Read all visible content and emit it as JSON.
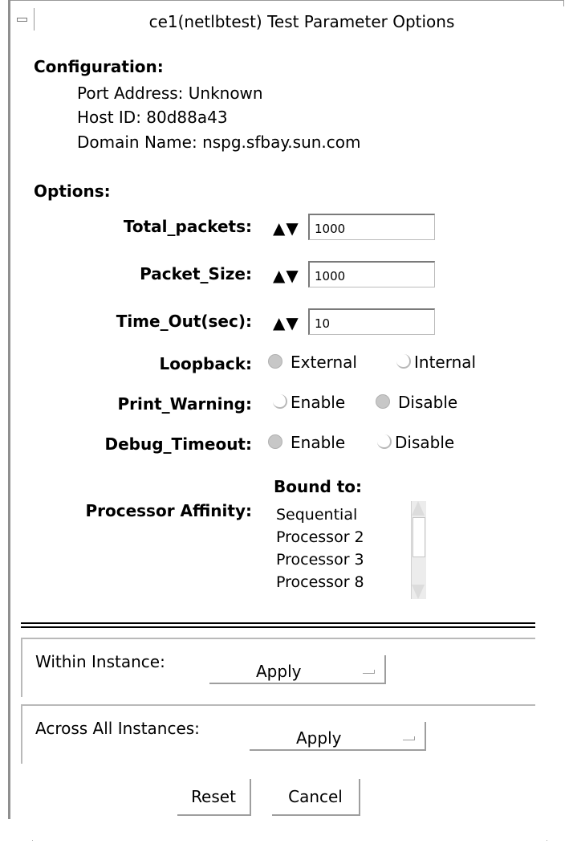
{
  "window": {
    "title": "ce1(netlbtest) Test Parameter Options"
  },
  "configuration": {
    "heading": "Configuration:",
    "port_address": "Port Address: Unknown",
    "host_id": "Host ID: 80d88a43",
    "domain_name": "Domain Name: nspg.sfbay.sun.com"
  },
  "options": {
    "heading": "Options:",
    "spinner_glyph": "▲▼",
    "total_packets": {
      "label": "Total_packets:",
      "value": "1000"
    },
    "packet_size": {
      "label": "Packet_Size:",
      "value": "1000"
    },
    "time_out": {
      "label": "Time_Out(sec):",
      "value": "10"
    },
    "loopback": {
      "label": "Loopback:",
      "choices": [
        "External",
        "Internal"
      ],
      "selected": "External"
    },
    "print_warning": {
      "label": "Print_Warning:",
      "choices": [
        "Enable",
        "Disable"
      ],
      "selected": "Disable"
    },
    "debug_timeout": {
      "label": "Debug_Timeout:",
      "choices": [
        "Enable",
        "Disable"
      ],
      "selected": "Enable"
    },
    "processor_affinity": {
      "label": "Processor Affinity:",
      "bound_heading": "Bound to:",
      "items": [
        "Sequential",
        "Processor 2",
        "Processor 3",
        "Processor 8"
      ]
    }
  },
  "apply": {
    "within_instance_label": "Within Instance:",
    "across_instances_label": "Across All Instances:",
    "apply_label": "Apply"
  },
  "buttons": {
    "reset": "Reset",
    "cancel": "Cancel"
  },
  "colors": {
    "selected_radio": "#c7c7c7",
    "border_gray": "#9e9e9e",
    "background": "#ffffff"
  }
}
